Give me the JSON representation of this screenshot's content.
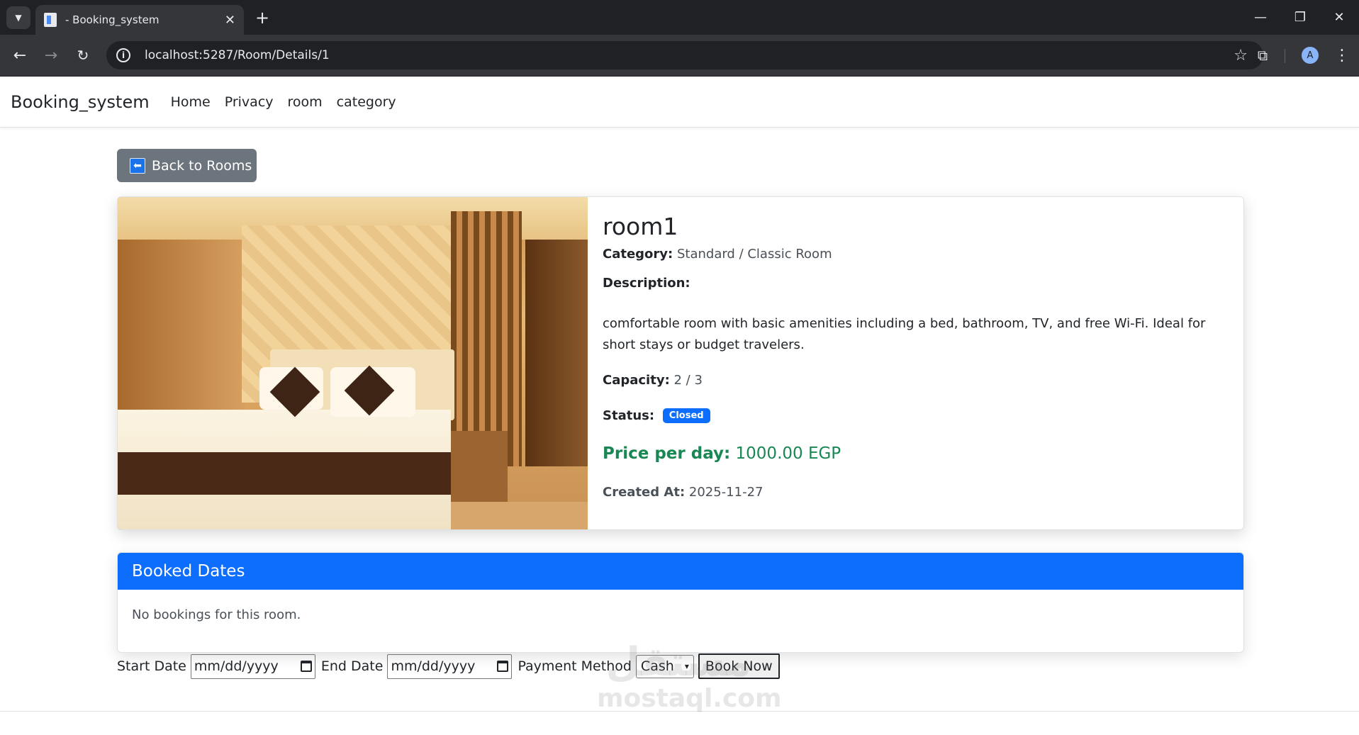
{
  "browser": {
    "tab_title": "- Booking_system",
    "tab_close": "✕",
    "new_tab": "+",
    "url": "localhost:5287/Room/Details/1",
    "avatar_letter": "A"
  },
  "navbar": {
    "brand": "Booking_system",
    "links": [
      "Home",
      "Privacy",
      "room",
      "category"
    ]
  },
  "back_button": {
    "arrow": "⬅",
    "label": "Back to Rooms"
  },
  "room": {
    "name": "room1",
    "category_label": "Category:",
    "category_value": "Standard / Classic Room",
    "description_label": "Description:",
    "description_value": "comfortable room with basic amenities including a bed, bathroom, TV, and free Wi-Fi. Ideal for short stays or budget travelers.",
    "capacity_label": "Capacity:",
    "capacity_value": "2 / 3",
    "status_label": "Status:",
    "status_value": "Closed",
    "price_label": "Price per day:",
    "price_value": "1000.00 EGP",
    "created_label": "Created At:",
    "created_value": "2025-11-27"
  },
  "booked_dates": {
    "title": "Booked Dates",
    "empty_text": "No bookings for this room."
  },
  "booking_form": {
    "start_label": "Start Date",
    "start_value": "mm/dd/yyyy",
    "end_label": "End Date",
    "end_value": "mm/dd/yyyy",
    "payment_label": "Payment Method",
    "payment_selected": "Cash",
    "submit_label": "Book Now"
  },
  "watermark": {
    "logo": "مستقل",
    "text": "mostaql.com"
  },
  "colors": {
    "primary": "#0d6efd",
    "success": "#198754",
    "secondary": "#6c757d"
  }
}
